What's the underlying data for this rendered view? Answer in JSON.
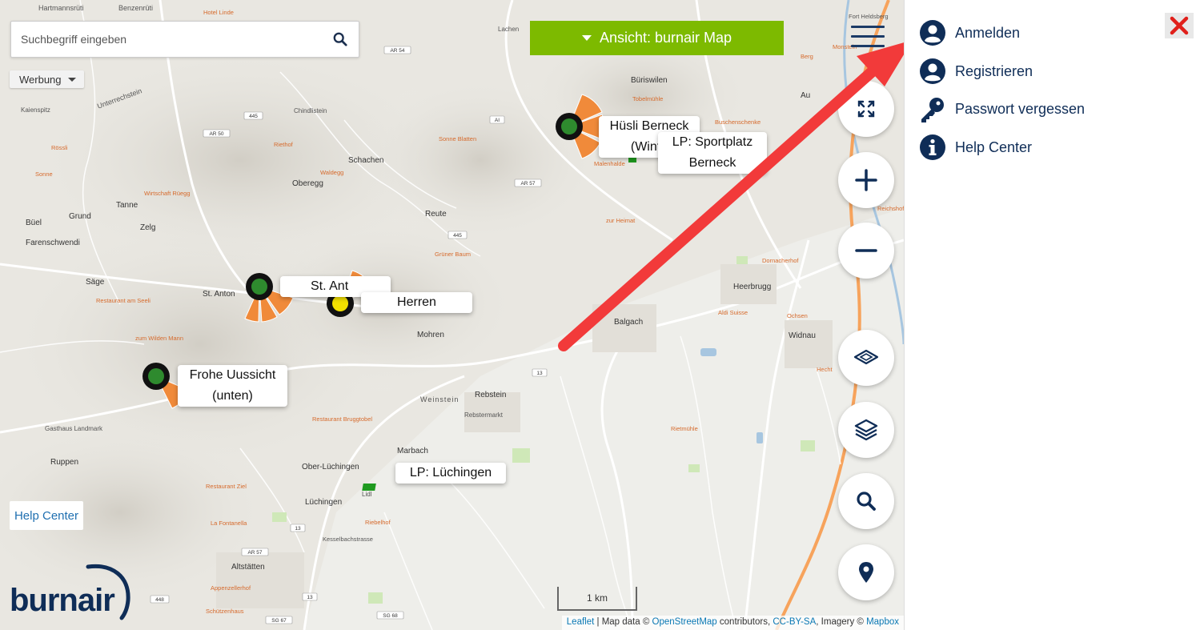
{
  "search": {
    "placeholder": "Suchbegriff eingeben"
  },
  "ad_toggle": {
    "label": "Werbung"
  },
  "view_selector": {
    "label": "Ansicht: burnair Map"
  },
  "map": {
    "places": [
      {
        "name": "Hartmannsrüti"
      },
      {
        "name": "Benzenrüti"
      },
      {
        "name": "Hotel Linde"
      },
      {
        "name": "Unterrechstein"
      },
      {
        "name": "Kaienspitz"
      },
      {
        "name": "Chindlistein"
      },
      {
        "name": "Rössli"
      },
      {
        "name": "Riethof"
      },
      {
        "name": "Sonne Blatten"
      },
      {
        "name": "Sonne"
      },
      {
        "name": "Oberegg"
      },
      {
        "name": "Waldegg"
      },
      {
        "name": "Schachen"
      },
      {
        "name": "Wirtschaft Rüegg"
      },
      {
        "name": "Tanne"
      },
      {
        "name": "Büel"
      },
      {
        "name": "Grund"
      },
      {
        "name": "Reute"
      },
      {
        "name": "Zelg"
      },
      {
        "name": "Farenschwendi"
      },
      {
        "name": "Grüner Baum"
      },
      {
        "name": "Säge"
      },
      {
        "name": "St. Anton"
      },
      {
        "name": "Restaurant am Seeli"
      },
      {
        "name": "zum Wilden Mann"
      },
      {
        "name": "Mohren"
      },
      {
        "name": "Weinstein"
      },
      {
        "name": "Rebstein"
      },
      {
        "name": "Rebstermarkt"
      },
      {
        "name": "Restaurant Bruggtobel"
      },
      {
        "name": "Gasthaus Landmark"
      },
      {
        "name": "Ruppen"
      },
      {
        "name": "Marbach"
      },
      {
        "name": "Ober-Lüchingen"
      },
      {
        "name": "Restaurant Ziel"
      },
      {
        "name": "Lüchingen"
      },
      {
        "name": "Lidl"
      },
      {
        "name": "Riebelhof"
      },
      {
        "name": "La Fontanella"
      },
      {
        "name": "Kesselbachstrasse"
      },
      {
        "name": "Altstätten"
      },
      {
        "name": "Appenzellerhof"
      },
      {
        "name": "Schützenhaus"
      },
      {
        "name": "Lachen"
      },
      {
        "name": "Büriswilen"
      },
      {
        "name": "Tobelmühle"
      },
      {
        "name": "Buschenschenke"
      },
      {
        "name": "Au"
      },
      {
        "name": "Monstein"
      },
      {
        "name": "Berg"
      },
      {
        "name": "Fort Heldsberg"
      },
      {
        "name": "Malenhalde"
      },
      {
        "name": "zur Heimat"
      },
      {
        "name": "Balgach"
      },
      {
        "name": "Heerbrugg"
      },
      {
        "name": "Widnau"
      },
      {
        "name": "Aldi Suisse"
      },
      {
        "name": "Ochsen"
      },
      {
        "name": "Hecht"
      },
      {
        "name": "Dornacherhof"
      },
      {
        "name": "Rietmühle"
      },
      {
        "name": "Reichshof"
      }
    ],
    "road_badges": [
      "AR 54",
      "445",
      "AI",
      "AR 50",
      "AR 57",
      "445",
      "13",
      "13",
      "13",
      "AR 57",
      "448",
      "SG 67",
      "SG 68"
    ],
    "markers": [
      {
        "label_line1": "Hüsli Berneck",
        "label_line2": "(Winte",
        "status": "green"
      },
      {
        "label_line1": "LP: Sportplatz",
        "label_line2": "Berneck",
        "status": "landing"
      },
      {
        "label_line1": "St. Ant",
        "label_line2": "",
        "status": "green"
      },
      {
        "label_line1": "Herren",
        "label_line2": "",
        "status": "yellow"
      },
      {
        "label_line1": "Frohe Uussicht",
        "label_line2": "(unten)",
        "status": "green"
      },
      {
        "label_line1": "LP: Lüchingen",
        "label_line2": "",
        "status": "landing"
      }
    ],
    "scale_label": "1 km",
    "help_center_label": "Help Center",
    "logo_text": "burnair",
    "attribution": {
      "leaflet": "Leaflet",
      "sep1": " | Map data © ",
      "osm": "OpenStreetMap",
      "contrib": " contributors, ",
      "license": "CC-BY-SA",
      "imagery": ", Imagery © ",
      "mapbox": "Mapbox"
    },
    "controls": [
      {
        "name": "fullscreen",
        "icon": "expand-icon"
      },
      {
        "name": "zoom-in",
        "icon": "plus-icon"
      },
      {
        "name": "zoom-out",
        "icon": "minus-icon"
      },
      {
        "name": "layer-3d",
        "icon": "layer-flat-icon"
      },
      {
        "name": "layers",
        "icon": "layers-icon"
      },
      {
        "name": "search",
        "icon": "search-icon"
      },
      {
        "name": "locate",
        "icon": "location-pin-icon"
      }
    ]
  },
  "side_menu": {
    "items": [
      {
        "label": "Anmelden",
        "icon": "user-circle-icon"
      },
      {
        "label": "Registrieren",
        "icon": "user-circle-icon"
      },
      {
        "label": "Passwort vergessen",
        "icon": "key-icon"
      },
      {
        "label": "Help Center",
        "icon": "info-circle-icon"
      }
    ],
    "close_icon": "close-x-icon"
  },
  "colors": {
    "brand_navy": "#0f2d57",
    "view_green": "#7dba00",
    "close_red": "#e0201b",
    "arrow_red": "#f23a3a",
    "marker_orange": "#f08a3a"
  }
}
